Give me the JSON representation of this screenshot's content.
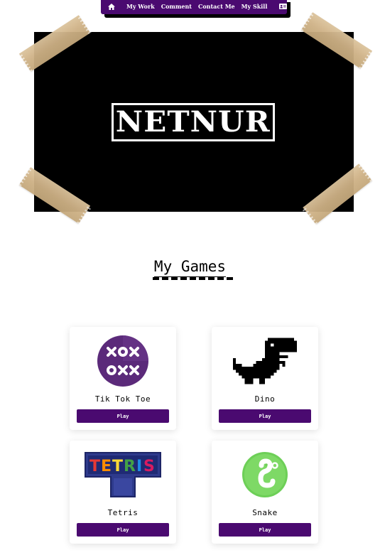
{
  "nav": {
    "icons": {
      "home": "home-icon",
      "id": "id-card-icon"
    },
    "items": [
      {
        "label": "My Work"
      },
      {
        "label": "Comment"
      },
      {
        "label": "Contact Me"
      },
      {
        "label": "My Skill"
      }
    ]
  },
  "hero": {
    "logo": "NETNUR"
  },
  "section": {
    "title": "My Games"
  },
  "games": [
    {
      "title": "Tik Tok Toe",
      "play_label": "Play",
      "icon": "tic-tac-toe-icon"
    },
    {
      "title": "Dino",
      "play_label": "Play",
      "icon": "dino-icon"
    },
    {
      "title": "Tetris",
      "play_label": "Play",
      "icon": "tetris-logo-icon"
    },
    {
      "title": "Snake",
      "play_label": "Play",
      "icon": "snake-icon"
    }
  ],
  "colors": {
    "brand": "#4a0a70",
    "hero_bg": "#000000",
    "tape": "#cdb084",
    "ttt_bg": "#5b2a7a",
    "snake_bg": "#6dcf57"
  }
}
